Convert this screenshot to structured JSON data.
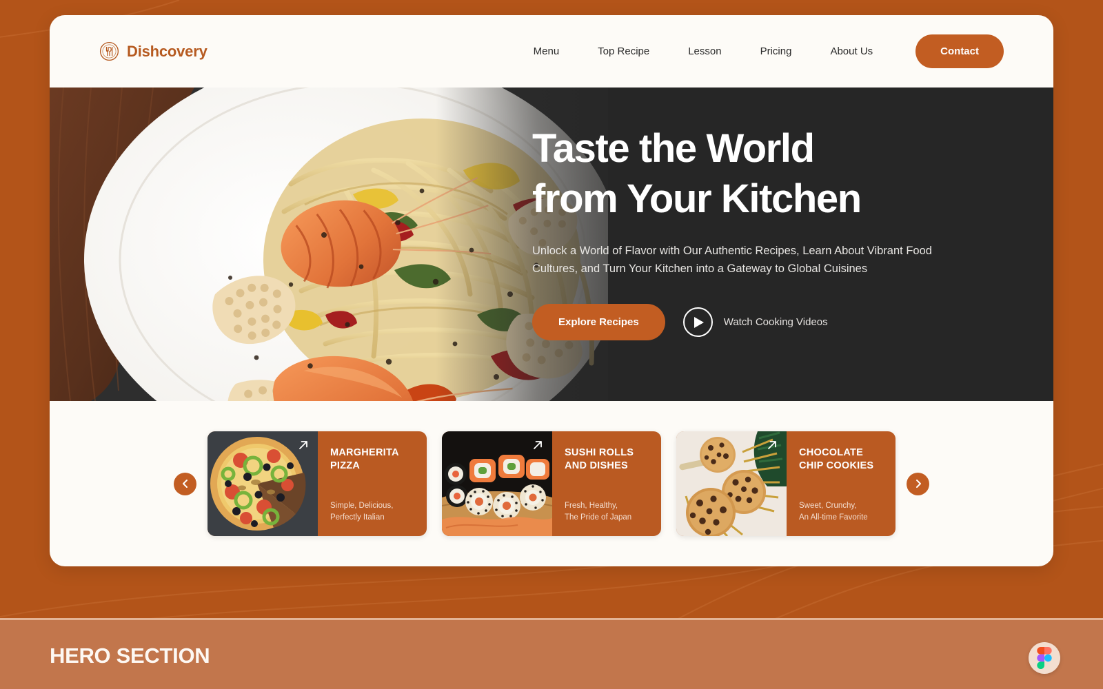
{
  "background": {
    "color": "#b35419",
    "band_color": "#c2764c",
    "band_border": "#e4b596"
  },
  "colors": {
    "accent": "#c25d22",
    "brand_text": "#b65a20",
    "card_surface": "#fdfbf7",
    "hero_dark": "#262626",
    "recipe_card": "#ba5a22"
  },
  "brand": {
    "name": "Dishcovery",
    "icon": "utensils-circle-icon"
  },
  "nav": {
    "links": [
      {
        "label": "Menu"
      },
      {
        "label": "Top Recipe"
      },
      {
        "label": "Lesson"
      },
      {
        "label": "Pricing"
      },
      {
        "label": "About Us"
      }
    ],
    "cta_label": "Contact"
  },
  "hero": {
    "title_line1": "Taste the World",
    "title_line2": "from Your Kitchen",
    "subtitle": "Unlock a World of Flavor with Our Authentic Recipes, Learn About Vibrant Food Cultures, and Turn Your Kitchen into a Gateway to Global Cuisines",
    "primary_cta": "Explore Recipes",
    "secondary_cta": "Watch Cooking Videos",
    "play_icon": "play-icon",
    "image_alt": "seafood-pasta-plate"
  },
  "carousel": {
    "prev_icon": "chevron-left-icon",
    "next_icon": "chevron-right-icon",
    "cards": [
      {
        "title": "MARGHERITA PIZZA",
        "desc_line1": "Simple, Delicious,",
        "desc_line2": "Perfectly Italian",
        "arrow_icon": "arrow-up-right-icon",
        "image_alt": "pizza-photo"
      },
      {
        "title": "SUSHI ROLLS AND DISHES",
        "desc_line1": "Fresh, Healthy,",
        "desc_line2": "The Pride of Japan",
        "arrow_icon": "arrow-up-right-icon",
        "image_alt": "sushi-photo"
      },
      {
        "title": "CHOCOLATE CHIP COOKIES",
        "desc_line1": "Sweet, Crunchy,",
        "desc_line2": "An All-time Favorite",
        "arrow_icon": "arrow-up-right-icon",
        "image_alt": "cookies-photo"
      }
    ]
  },
  "footer": {
    "section_label": "HERO SECTION",
    "badge_icon": "figma-logo-icon"
  }
}
